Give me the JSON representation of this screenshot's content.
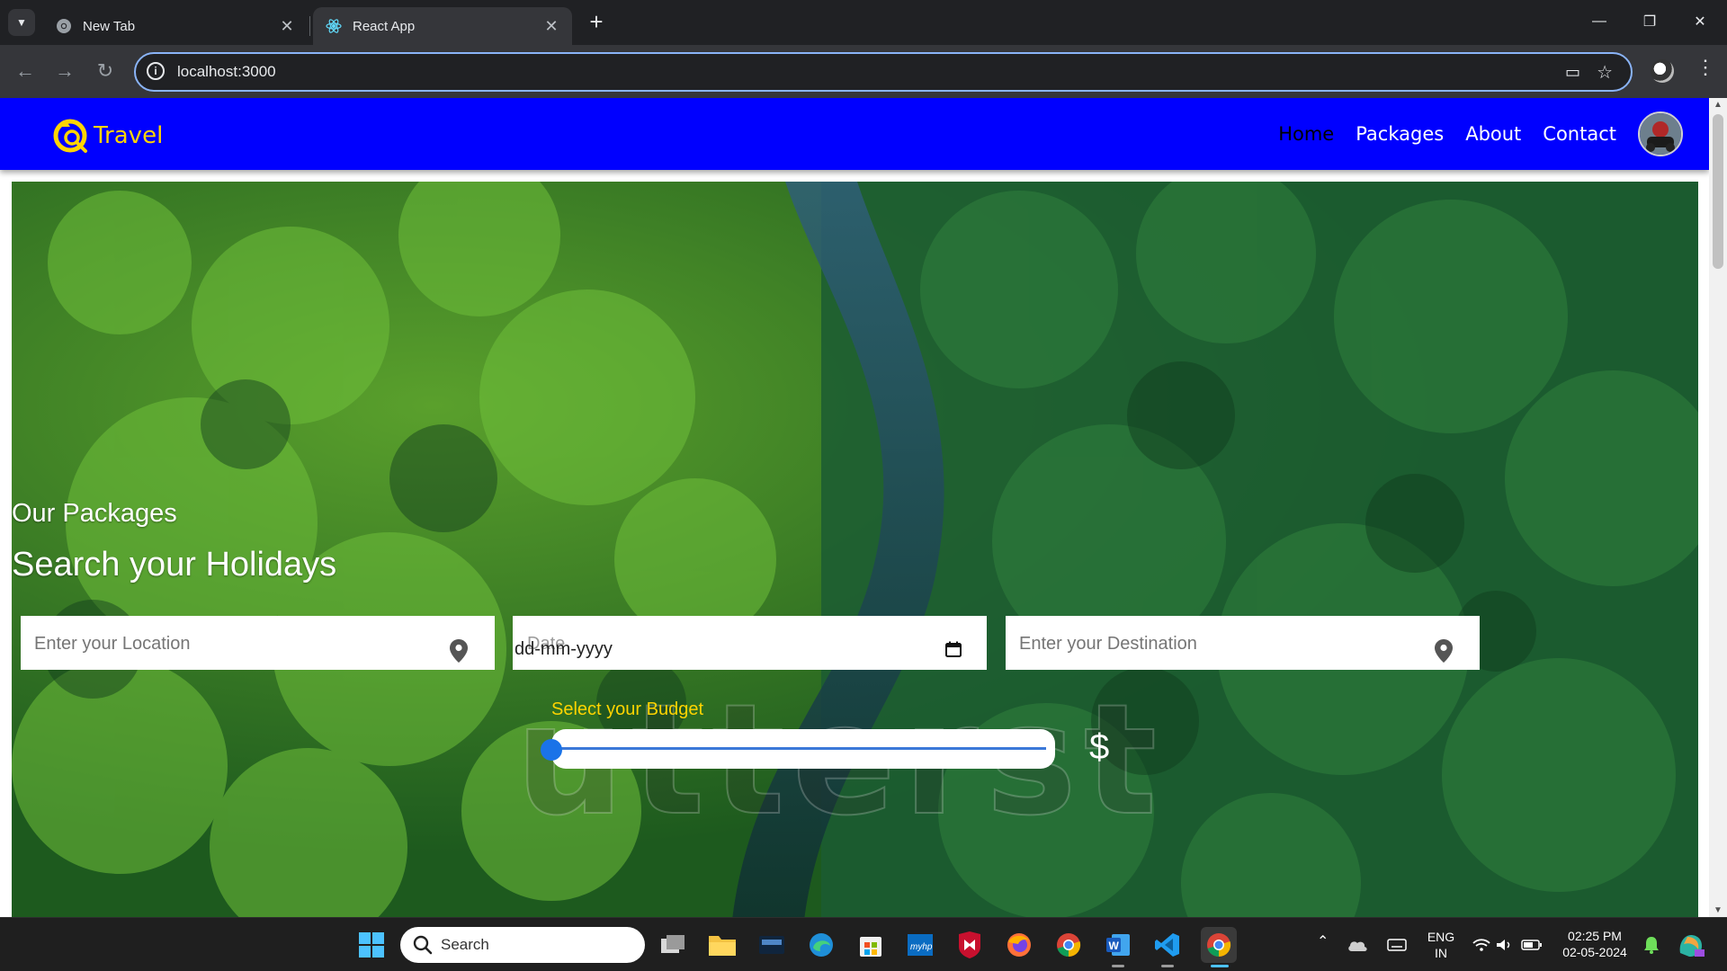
{
  "browser": {
    "tabs": [
      {
        "title": "New Tab",
        "active": false
      },
      {
        "title": "React App",
        "active": true
      }
    ],
    "url": "localhost:3000"
  },
  "site": {
    "brand": "Travel",
    "nav": {
      "home": "Home",
      "packages": "Packages",
      "about": "About",
      "contact": "Contact"
    },
    "colors": {
      "navbar": "#0000ff",
      "brand": "#ffd400",
      "active_link": "#000000"
    }
  },
  "hero": {
    "subtitle": "Our Packages",
    "title": "Search your Holidays",
    "location_placeholder": "Enter your Location",
    "date_placeholder": "Date",
    "date_format": "dd-mm-yyyy",
    "destination_placeholder": "Enter your Destination",
    "budget_label": "Select your Budget",
    "budget_value": 0,
    "currency_symbol": "$",
    "watermark": "utterst"
  },
  "taskbar": {
    "search_text": "Search",
    "language": "ENG",
    "region": "IN",
    "time": "02:25 PM",
    "date": "02-05-2024"
  }
}
